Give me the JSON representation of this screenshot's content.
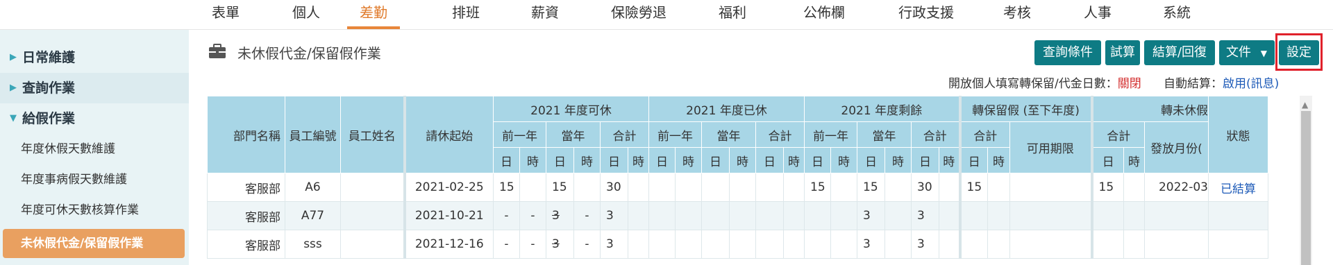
{
  "nav": [
    "表單",
    "個人",
    "差勤",
    "排班",
    "薪資",
    "保險勞退",
    "福利",
    "公佈欄",
    "行政支援",
    "考核",
    "人事",
    "系統"
  ],
  "sidebar": {
    "sections": [
      "日常維護",
      "查詢作業",
      "給假作業"
    ],
    "subitems": [
      "年度休假天數維護",
      "年度事病假天數維護",
      "年度可休天數核算作業"
    ],
    "active": "未休假代金/保留假作業"
  },
  "page": {
    "title": "未休假代金/保留假作業"
  },
  "buttons": {
    "query": "查詢條件",
    "trial": "試算",
    "settle": "結算/回復",
    "doc": "文件",
    "settings": "設定"
  },
  "options": {
    "open_label": "開放個人填寫轉保留/代金日數：",
    "open_value": "關閉",
    "auto_label": "自動結算：",
    "auto_value": "啟用(訊息)"
  },
  "table": {
    "h_dept": "部門名稱",
    "h_empno": "員工編號",
    "h_name": "員工姓名",
    "h_start": "請休起始",
    "g_can": "2021 年度可休",
    "g_used": "2021 年度已休",
    "g_left": "2021 年度剩餘",
    "g_keep": "轉保留假 (至下年度)",
    "g_pay": "轉未休假",
    "prev": "前一年",
    "cur": "當年",
    "total": "合計",
    "expire": "可用期限",
    "paymonth": "發放月份(",
    "status": "狀態",
    "day": "日",
    "hour": "時",
    "rows": [
      {
        "dept": "客服部",
        "empno": "A6",
        "name": "",
        "start": "2021-02-25",
        "c": [
          "15",
          "",
          "15",
          "",
          "30",
          ""
        ],
        "u": [
          "",
          "",
          "",
          "",
          "",
          ""
        ],
        "l": [
          "15",
          "",
          "15",
          "",
          "30",
          ""
        ],
        "k": [
          "15",
          "",
          ""
        ],
        "p": [
          "15",
          "",
          "2022-03"
        ],
        "status": "已結算"
      },
      {
        "dept": "客服部",
        "empno": "A77",
        "name": "",
        "start": "2021-10-21",
        "c": [
          "-",
          "-",
          "3",
          "-",
          "3",
          ""
        ],
        "u": [
          "",
          "",
          "",
          "",
          "",
          ""
        ],
        "l": [
          "",
          "",
          "3",
          "",
          "3",
          ""
        ],
        "k": [
          "",
          "",
          ""
        ],
        "p": [
          "",
          "",
          ""
        ],
        "status": ""
      },
      {
        "dept": "客服部",
        "empno": "sss",
        "name": "",
        "start": "2021-12-16",
        "c": [
          "-",
          "-",
          "3",
          "-",
          "3",
          ""
        ],
        "u": [
          "",
          "",
          "",
          "",
          "",
          ""
        ],
        "l": [
          "",
          "",
          "3",
          "",
          "3",
          ""
        ],
        "k": [
          "",
          "",
          ""
        ],
        "p": [
          "",
          "",
          ""
        ],
        "status": ""
      }
    ]
  }
}
